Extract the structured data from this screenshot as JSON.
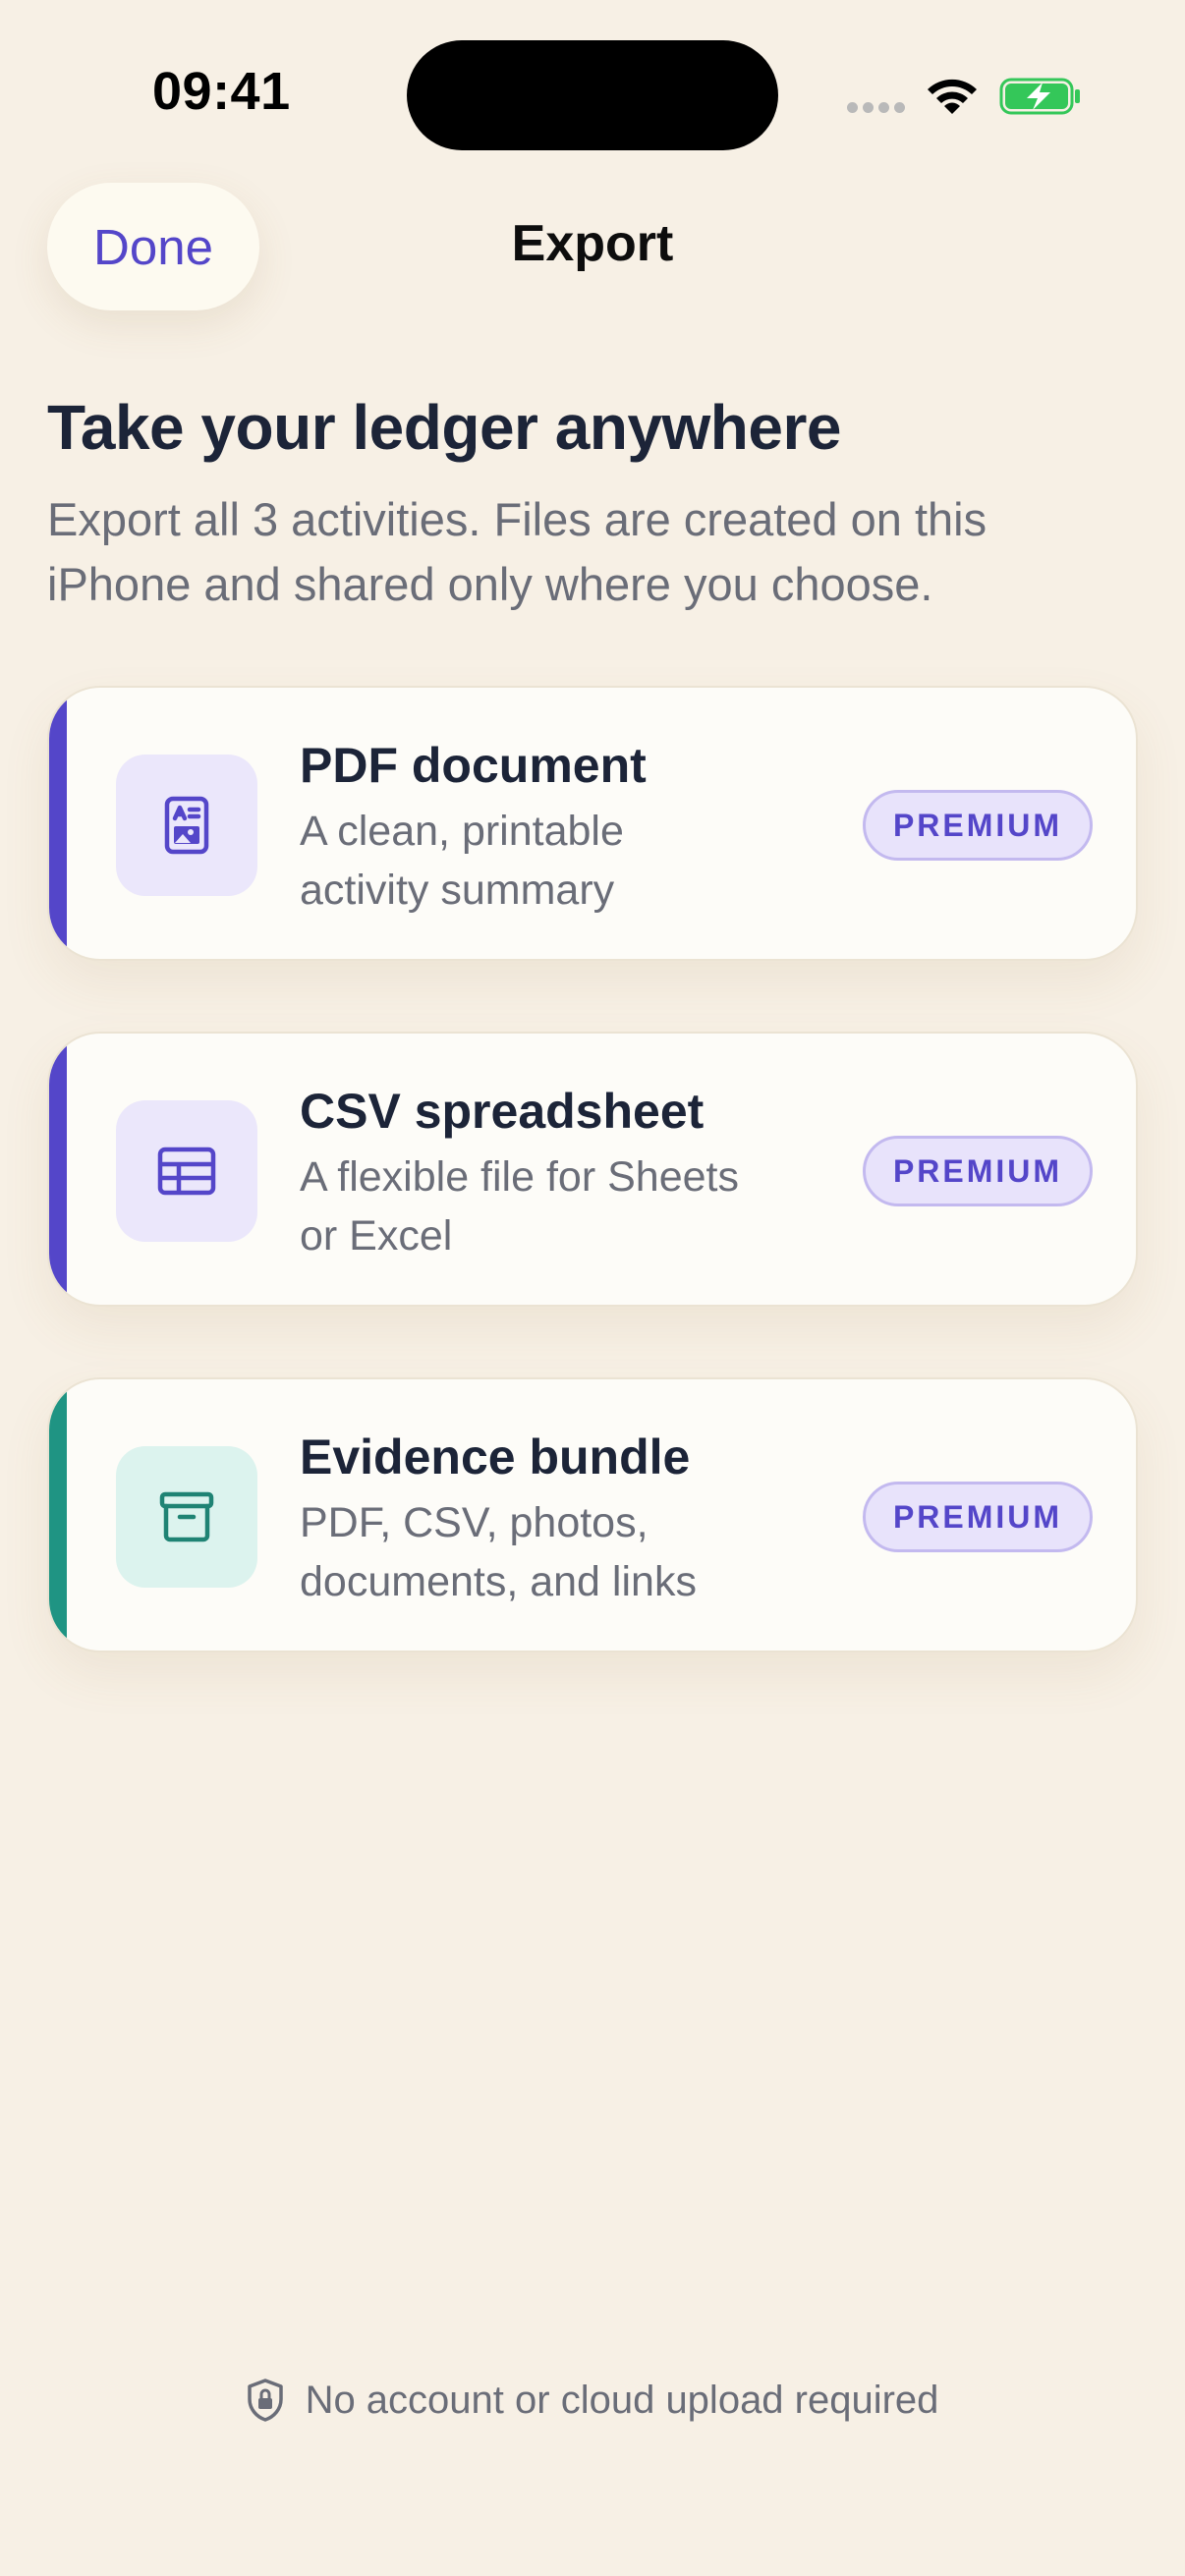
{
  "status_bar": {
    "time": "09:41"
  },
  "nav": {
    "done_label": "Done",
    "title": "Export"
  },
  "header": {
    "headline": "Take your ledger anywhere",
    "subtext": "Export all 3 activities. Files are created on this iPhone and shared only where you choose."
  },
  "options": [
    {
      "title": "PDF document",
      "description": "A clean, printable activity summary",
      "badge": "PREMIUM",
      "icon": "pdf-document-icon",
      "accent": "#5446c9",
      "tile_bg": "#ebe7fb",
      "icon_color": "#5446c9"
    },
    {
      "title": "CSV spreadsheet",
      "description": "A flexible file for Sheets or Excel",
      "badge": "PREMIUM",
      "icon": "spreadsheet-icon",
      "accent": "#5446c9",
      "tile_bg": "#ebe7fb",
      "icon_color": "#5446c9"
    },
    {
      "title": "Evidence bundle",
      "description": "PDF, CSV, photos, documents, and links",
      "badge": "PREMIUM",
      "icon": "archive-box-icon",
      "accent": "#1f9483",
      "tile_bg": "#dcf3ee",
      "icon_color": "#1f8374"
    }
  ],
  "footer": {
    "text": "No account or cloud upload required",
    "icon": "lock-shield-icon"
  },
  "colors": {
    "background": "#f7f0e5",
    "accent": "#5446c9",
    "teal": "#1f9483"
  }
}
